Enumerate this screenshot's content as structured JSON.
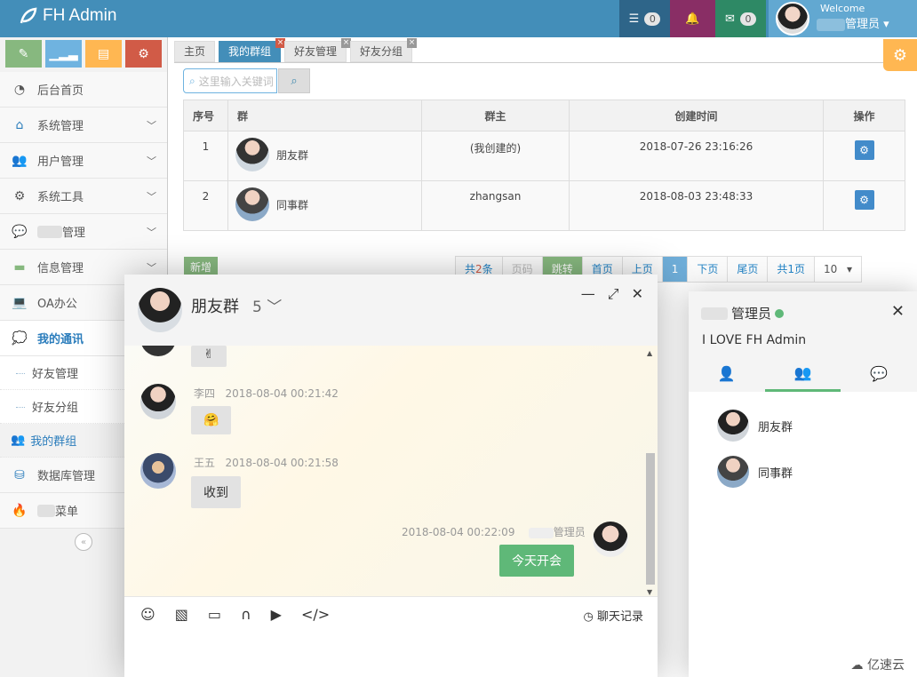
{
  "app": {
    "brand": "FH Admin",
    "welcome": "Welcome",
    "username": "管理员"
  },
  "navbar": {
    "msg_count": "0",
    "mail_count": "0"
  },
  "sidebar": {
    "items": [
      {
        "label": "后台首页",
        "icon": "dashboard-icon"
      },
      {
        "label": "系统管理",
        "icon": "home-icon"
      },
      {
        "label": "用户管理",
        "icon": "users-icon"
      },
      {
        "label": "系统工具",
        "icon": "gear-icon"
      },
      {
        "label": "管理",
        "icon": "chat-icon"
      },
      {
        "label": "信息管理",
        "icon": "card-icon"
      },
      {
        "label": "OA办公",
        "icon": "laptop-icon"
      },
      {
        "label": "我的通讯",
        "icon": "comments-icon"
      },
      {
        "label": "好友管理"
      },
      {
        "label": "好友分组"
      },
      {
        "label": "我的群组",
        "icon": "group-icon"
      },
      {
        "label": "数据库管理",
        "icon": "database-icon"
      },
      {
        "label": "菜单",
        "icon": "fire-icon"
      }
    ]
  },
  "tabs": [
    {
      "label": "主页"
    },
    {
      "label": "我的群组"
    },
    {
      "label": "好友管理"
    },
    {
      "label": "好友分组"
    }
  ],
  "search": {
    "placeholder": "这里输入关键词"
  },
  "table": {
    "headers": [
      "序号",
      "群",
      "群主",
      "创建时间",
      "操作"
    ],
    "rows": [
      {
        "no": "1",
        "group": "朋友群",
        "owner": "(我创建的)",
        "created": "2018-07-26 23:16:26"
      },
      {
        "no": "2",
        "group": "同事群",
        "owner": "zhangsan",
        "created": "2018-08-03 23:48:33"
      }
    ]
  },
  "add_label": "新增",
  "pager": {
    "total_prefix": "共",
    "total_num": "2",
    "total_suffix": "条",
    "page_input": "页码",
    "jump": "跳转",
    "first": "首页",
    "prev": "上页",
    "current": "1",
    "next": "下页",
    "last": "尾页",
    "pages": "共1页",
    "size": "10"
  },
  "chat": {
    "title": "朋友群",
    "count": "5",
    "messages": [
      {
        "name": "李四",
        "time": "2018-08-04 00:21:42"
      },
      {
        "name": "王五",
        "time": "2018-08-04 00:21:58",
        "text": "收到"
      },
      {
        "time": "2018-08-04 00:22:09",
        "name": "管理员",
        "text": "今天开会"
      }
    ],
    "history": "聊天记录"
  },
  "list": {
    "username": "管理员",
    "sign": "I LOVE FH Admin",
    "groups": [
      "朋友群",
      "同事群"
    ]
  },
  "watermark": "亿速云"
}
